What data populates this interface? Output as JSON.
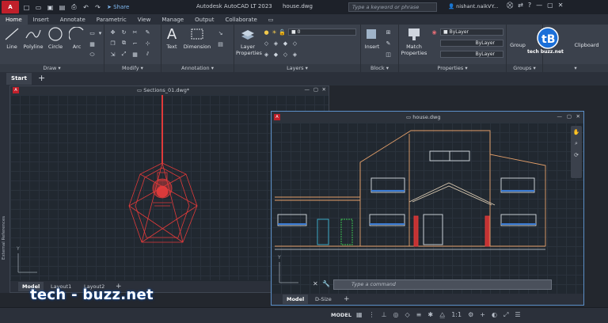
{
  "titlebar": {
    "app_icon_label": "A",
    "share_label": "Share",
    "app_title": "Autodesk AutoCAD LT 2023",
    "doc_title": "house.dwg",
    "search_placeholder": "Type a keyword or phrase",
    "user": "nishant.naikVY..."
  },
  "tabs": [
    "Home",
    "Insert",
    "Annotate",
    "Parametric",
    "View",
    "Manage",
    "Output",
    "Collaborate"
  ],
  "ribbon": {
    "draw": {
      "label": "Draw",
      "tools": [
        "Line",
        "Polyline",
        "Circle",
        "Arc"
      ]
    },
    "modify": {
      "label": "Modify"
    },
    "annotation": {
      "label": "Annotation",
      "tools": [
        "Text",
        "Dimension"
      ]
    },
    "layers": {
      "label": "Layers",
      "layer_props": "Layer Properties",
      "current_layer": "0"
    },
    "block": {
      "label": "Block",
      "insert": "Insert"
    },
    "properties": {
      "label": "Properties",
      "match": "Match Properties",
      "bylayer": "ByLayer"
    },
    "groups": {
      "label": "Groups",
      "group": "Group"
    },
    "clipboard": {
      "label": "Clipboard"
    }
  },
  "doc_tabs": {
    "start": "Start"
  },
  "left_window": {
    "title": "Sections_01.dwg*",
    "side_label": "External References",
    "ucs_y": "Y",
    "tabs": [
      "Model",
      "Layout1",
      "Layout2"
    ]
  },
  "right_window": {
    "title": "house.dwg",
    "command_placeholder": "Type a command",
    "ucs_y": "Y",
    "tabs": [
      "Model",
      "D-Size"
    ]
  },
  "status": {
    "model": "MODEL",
    "scale": "1:1"
  },
  "watermark": {
    "text": "tech - buzz.net",
    "logo_text": "tech buzz.net",
    "logo_letters": "tB"
  },
  "colors": {
    "accent": "#5b8fc7",
    "drawing_red": "#e03a3a",
    "house_orange": "#e5a06a",
    "house_blue": "#3a7bd5",
    "house_cyan": "#3fb6d6",
    "house_green": "#3fcc55"
  }
}
